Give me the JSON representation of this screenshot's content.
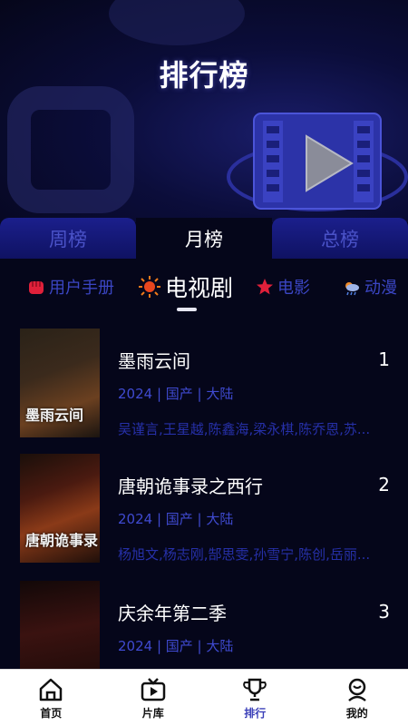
{
  "header": {
    "title": "排行榜"
  },
  "tabs": [
    {
      "label": "周榜",
      "active": false
    },
    {
      "label": "月榜",
      "active": true
    },
    {
      "label": "总榜",
      "active": false
    }
  ],
  "categories": [
    {
      "label": "用户手册",
      "icon": "fist-icon",
      "active": false
    },
    {
      "label": "电视剧",
      "icon": "sun-icon",
      "active": true
    },
    {
      "label": "电影",
      "icon": "star-icon",
      "active": false
    },
    {
      "label": "动漫",
      "icon": "cloud-rain-icon",
      "active": false
    }
  ],
  "items": [
    {
      "title": "墨雨云间",
      "rank": "1",
      "meta": "2024 | 国产 | 大陆",
      "cast": "吴谨言,王星越,陈鑫海,梁永棋,陈乔恩,苏...",
      "poster_text": "墨雨云间"
    },
    {
      "title": "唐朝诡事录之西行",
      "rank": "2",
      "meta": "2024 | 国产 | 大陆",
      "cast": "杨旭文,杨志刚,郜思雯,孙雪宁,陈创,岳丽...",
      "poster_text": "唐朝诡事录"
    },
    {
      "title": "庆余年第二季",
      "rank": "3",
      "meta": "2024 | 国产 | 大陆",
      "cast": "",
      "poster_text": ""
    }
  ],
  "bottom_nav": [
    {
      "label": "首页",
      "icon": "home-icon",
      "active": false
    },
    {
      "label": "片库",
      "icon": "tv-icon",
      "active": false
    },
    {
      "label": "排行",
      "icon": "trophy-icon",
      "active": true
    },
    {
      "label": "我的",
      "icon": "user-icon",
      "active": false
    }
  ],
  "colors": {
    "background": "#05061a",
    "accent": "#3f4ad0",
    "tab_inactive": "#1b1f8c"
  }
}
